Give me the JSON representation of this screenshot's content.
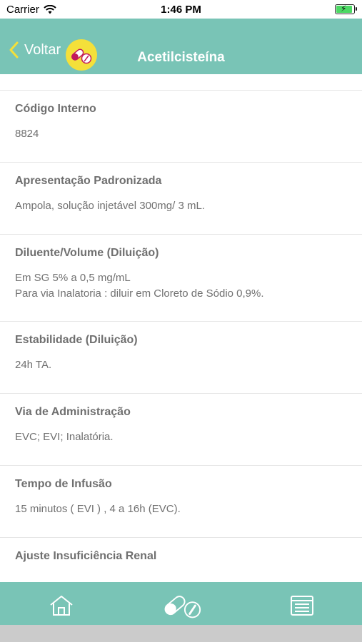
{
  "status_bar": {
    "carrier": "Carrier",
    "time": "1:46 PM",
    "battery_color": "#4cd964"
  },
  "nav": {
    "back_label": "Voltar",
    "title": "Acetilcisteína",
    "logo_icon": "pills-icon",
    "bar_color": "#79c4b6",
    "logo_color": "#f4e03a"
  },
  "fields": [
    {
      "label": "Código Interno",
      "value": "8824"
    },
    {
      "label": "Apresentação Padronizada",
      "value": "Ampola, solução injetável 300mg/ 3 mL."
    },
    {
      "label": "Diluente/Volume (Diluição)",
      "value": "Em SG 5% a 0,5 mg/mL\nPara via Inalatoria : diluir em Cloreto de Sódio 0,9%."
    },
    {
      "label": "Estabilidade (Diluição)",
      "value": "24h TA."
    },
    {
      "label": "Via de Administração",
      "value": "EVC; EVI; Inalatória."
    },
    {
      "label": "Tempo de Infusão",
      "value": "15 minutos ( EVI ) , 4 a 16h (EVC)."
    },
    {
      "label": "Ajuste Insuficiência Renal",
      "value": ""
    }
  ],
  "tab_bar": {
    "tabs": [
      {
        "icon": "home-icon"
      },
      {
        "icon": "pills-icon"
      },
      {
        "icon": "document-icon"
      }
    ]
  }
}
